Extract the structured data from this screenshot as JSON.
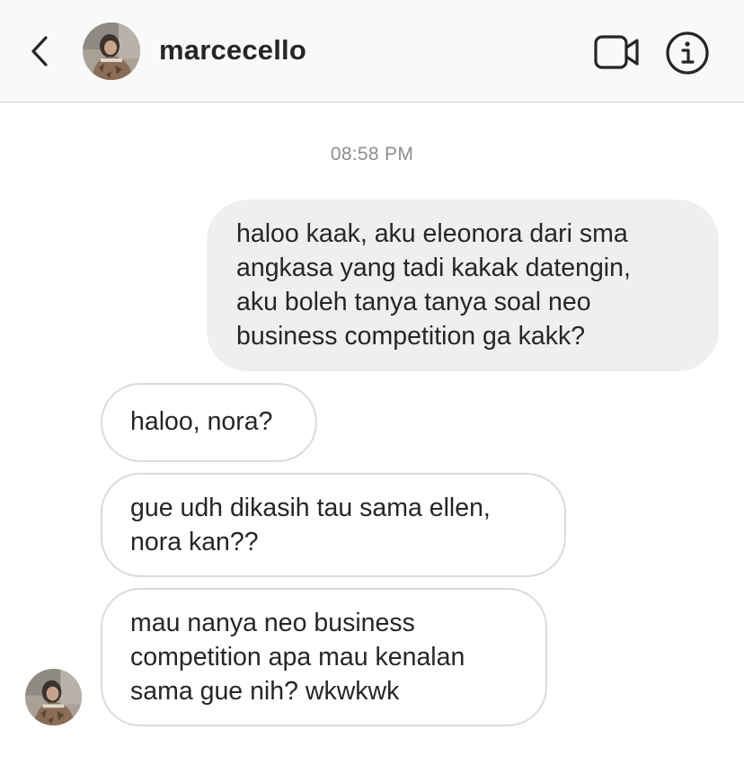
{
  "header": {
    "username": "marcecello",
    "back_icon": "chevron-left-icon",
    "video_icon": "video-camera-icon",
    "info_icon": "info-circle-icon"
  },
  "conversation": {
    "timestamp": "08:58 PM",
    "messages": [
      {
        "direction": "sent",
        "lines": [
          "haloo kaak, aku eleonora dari sma",
          "angkasa yang tadi kakak datengin,",
          "aku boleh tanya tanya soal neo",
          "business competition ga kakk?"
        ]
      },
      {
        "direction": "received",
        "lines": [
          "haloo, nora?"
        ]
      },
      {
        "direction": "received",
        "lines": [
          "gue udh dikasih tau sama ellen,",
          "nora kan??"
        ]
      },
      {
        "direction": "received",
        "lines": [
          "mau nanya neo business",
          "competition apa mau kenalan",
          "sama gue nih? wkwkwk"
        ]
      }
    ]
  },
  "colors": {
    "header_bg": "#f9f9f9",
    "sent_bubble_bg": "#efefef",
    "received_bubble_border": "#dbdbdb",
    "text": "#262626",
    "timestamp": "#8e8e8e"
  }
}
